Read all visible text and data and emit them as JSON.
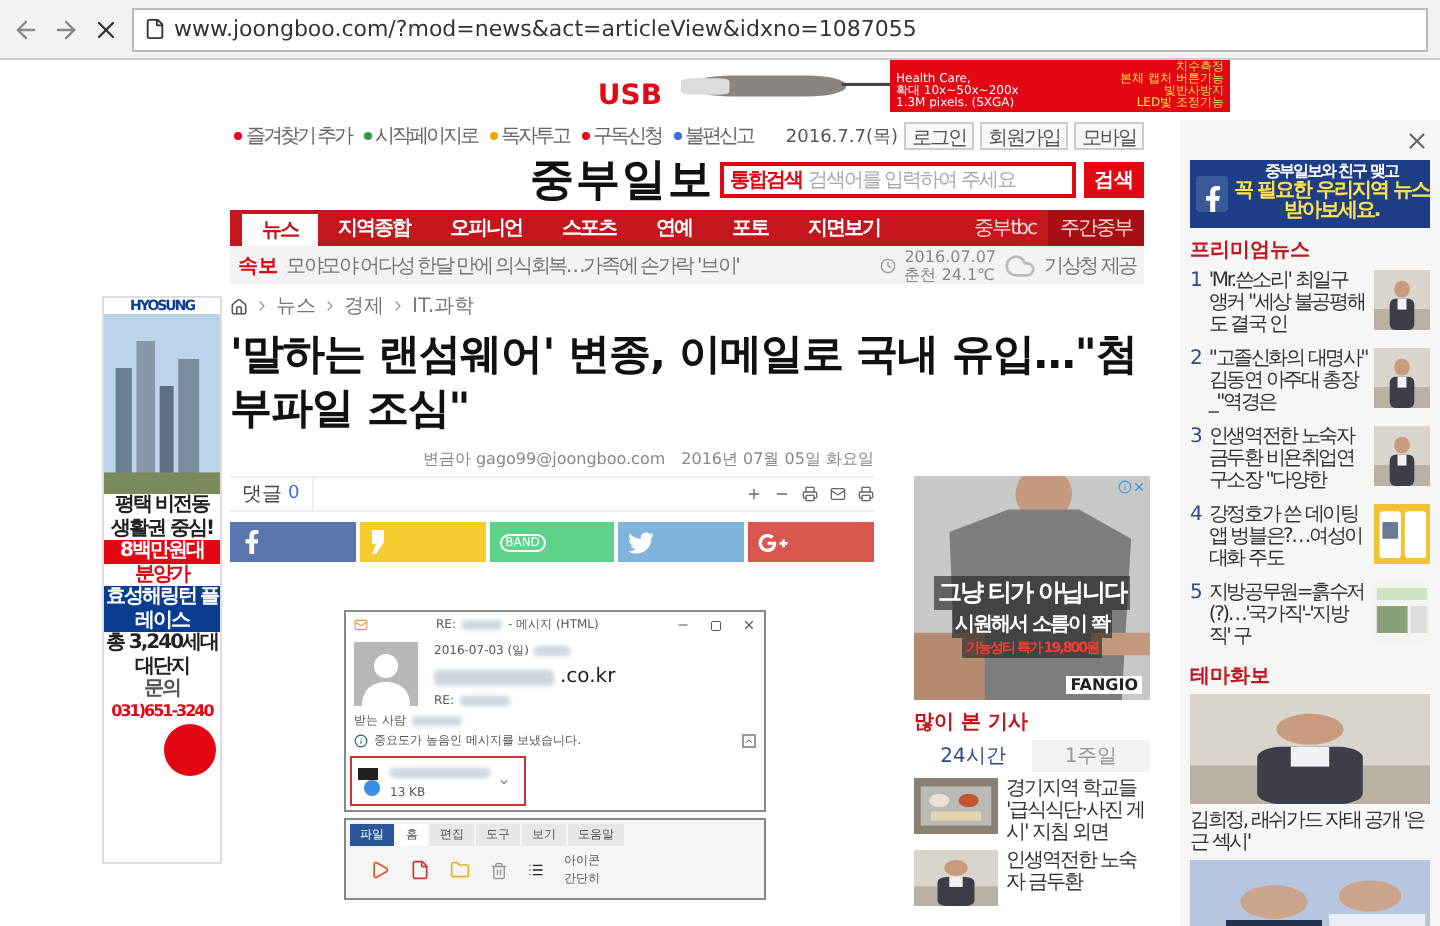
{
  "browser": {
    "url": "www.joongboo.com/?mod=news&act=articleView&idxno=1087055"
  },
  "top_ad": {
    "brand_text": "USB",
    "lines": [
      "Health Care,",
      "확대 10x~50x~200x",
      "1.3M pixels. (SXGA)"
    ],
    "features": [
      "치수측정",
      "본체 캡처 버튼기능",
      "빛반사방지",
      "LED빛 조정기능"
    ]
  },
  "utility_links": [
    "즐겨찾기 추가",
    "시작페이지로",
    "독자투고",
    "구독신청",
    "불편신고"
  ],
  "date": "2016.7.7(목)",
  "account_buttons": [
    "로그인",
    "회원가입",
    "모바일"
  ],
  "logo": "중부일보",
  "search": {
    "label": "통합검색",
    "placeholder": "검색어를 입력하여 주세요",
    "button": "검색"
  },
  "nav": {
    "items": [
      {
        "label": "뉴스",
        "selected": true
      },
      {
        "label": "지역종합",
        "selected": false
      },
      {
        "label": "오피니언",
        "selected": false
      },
      {
        "label": "스포츠",
        "selected": false
      },
      {
        "label": "연예",
        "selected": false
      },
      {
        "label": "포토",
        "selected": false
      },
      {
        "label": "지면보기",
        "selected": false
      }
    ],
    "extras": [
      "중부tbc",
      "주간중부"
    ]
  },
  "breaking": {
    "tag": "속보",
    "text": "모야모야 어다성 한달 만에 의식회복…가족에 손가락 '브이'"
  },
  "weather": {
    "date": "2016.07.07",
    "reading": "춘천 24.1℃",
    "source": "기상청 제공"
  },
  "breadcrumb": [
    "뉴스",
    "경제",
    "IT.과학"
  ],
  "headline": "'말하는 랜섬웨어' 변종, 이메일로 국내 유입…\"첨부파일 조심\"",
  "byline": {
    "author": "변금아 gago99@joongboo.com",
    "date": "2016년 07월 05일 화요일"
  },
  "comments": {
    "label": "댓글",
    "count": "0"
  },
  "share_buttons": [
    {
      "kind": "facebook"
    },
    {
      "kind": "kakaostory"
    },
    {
      "kind": "band",
      "label": "BAND"
    },
    {
      "kind": "twitter"
    },
    {
      "kind": "googleplus"
    }
  ],
  "figure": {
    "title_prefix": "RE:",
    "title_suffix": "- 메시지 (HTML)",
    "date": "2016-07-03 (일)",
    "sender_domain": ".co.kr",
    "subject_prefix": "RE:",
    "to_label": "받는 사람",
    "notice": "중요도가 높음인 메시지를 보냈습니다.",
    "attachment_size": "13 KB",
    "ribbon_tabs": [
      {
        "label": "파일",
        "kind": "file",
        "selected": false
      },
      {
        "label": "홈",
        "kind": "tab",
        "selected": true
      },
      {
        "label": "편집",
        "kind": "tab",
        "selected": false
      },
      {
        "label": "도구",
        "kind": "tab",
        "selected": false
      },
      {
        "label": "보기",
        "kind": "tab",
        "selected": false
      },
      {
        "label": "도움말",
        "kind": "tab",
        "selected": false
      }
    ],
    "ribbon_labels": [
      "아이콘",
      "간단히"
    ]
  },
  "side_ad": {
    "headline": "그냥 티가 아닙니다",
    "subline": "시원해서 소름이 쫙",
    "offer": "기능성티 특가 19,800원",
    "brand": "FANGIO"
  },
  "most_viewed": {
    "title": "많이 본 기사",
    "tabs": [
      {
        "label": "24시간",
        "selected": true
      },
      {
        "label": "1주일",
        "selected": false
      }
    ],
    "items": [
      "경기지역 학교들 '급식식단·사진 게시' 지침 외면",
      "인생역전한 노숙자 금두환"
    ]
  },
  "left_ad": {
    "brand": "HYOSUNG",
    "headline": [
      "평택 비전동",
      "생활권 중심!"
    ],
    "price": "8백만원대",
    "price_sub": "분양가",
    "project": "효성해링턴 플레이스",
    "units": "총 3,240세대",
    "units_sub": "대단지",
    "contact_label": "문의",
    "phone": "031)651-3240"
  },
  "facebook_banner": [
    "중부일보와 친구 맺고",
    "꼭 필요한 우리지역 뉴스",
    "받아보세요."
  ],
  "premium": {
    "title": "프리미엄뉴스",
    "items": [
      {
        "rank": "1",
        "title": "'Mr.쓴소리' 최일구 앵커 \"세상 불공평해도 결국 인"
      },
      {
        "rank": "2",
        "title": "\"고졸신화의 대명사\" 김동연 아주대 총장 _\"역경은"
      },
      {
        "rank": "3",
        "title": "인생역전한 노숙자 금두환 비욘취업연구소장 \"다양한"
      },
      {
        "rank": "4",
        "title": "강정호가 쓴 데이팅앱 벙블은?…여성이 대화 주도"
      },
      {
        "rank": "5",
        "title": "지방공무원=흙수저(?)…'국가직'-'지방직' 구"
      }
    ]
  },
  "theme_gallery": {
    "title": "테마화보",
    "caption": "김희정, 래쉬가드 자태 공개 '은근 섹시'"
  }
}
